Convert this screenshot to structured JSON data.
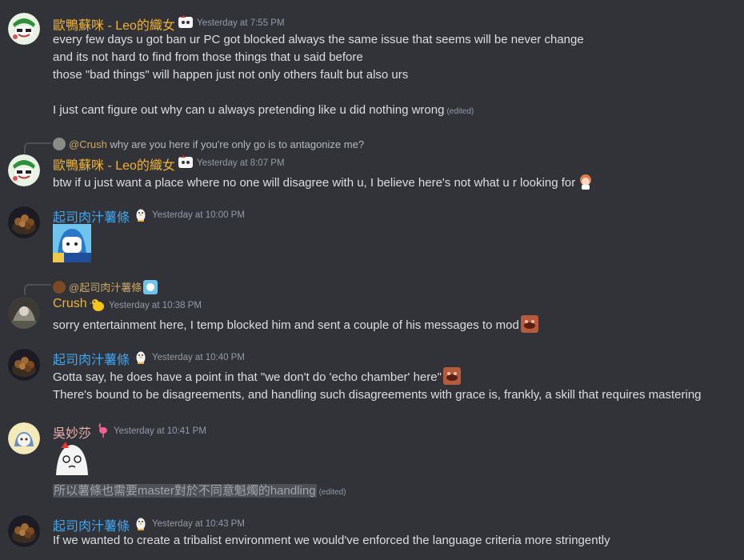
{
  "colors": {
    "background": "#313338",
    "text": "#dbdee1",
    "muted": "#949ba4",
    "gold_name": "#f0b232",
    "blue_name": "#3ea8f5",
    "pink_name": "#f0b0b0",
    "reply_mention": "#c9a86a"
  },
  "messages": [
    {
      "author": "歐鴨蘇咪 - Leo的織女",
      "timestamp": "Yesterday at 7:55 PM",
      "lines": [
        "every few days u got ban ur PC got blocked always the same issue that seems will be never change",
        "and its not hard to find from those things that u said before",
        "those \"bad things\" will happen just not only others fault but also urs",
        "I just cant figure out why can u always pretending like  u did nothing wrong"
      ],
      "edited": "(edited)"
    },
    {
      "reply": {
        "mention": "@Crush",
        "text": "why are you here if you're only go is to antagonize me?"
      },
      "author": "歐鴨蘇咪 - Leo的織女",
      "timestamp": "Yesterday at 8:07 PM",
      "lines": [
        "btw if u just want a place where no one will disagree with u, I believe here's not what u r looking for"
      ]
    },
    {
      "author": "起司肉汁薯條",
      "timestamp": "Yesterday at 10:00 PM",
      "lines": []
    },
    {
      "reply": {
        "mention": "@起司肉汁薯條",
        "text": ""
      },
      "author": "Crush",
      "timestamp": "Yesterday at 10:38 PM",
      "lines": [
        "sorry entertainment here, I temp blocked him and sent a couple  of his messages to mod"
      ]
    },
    {
      "author": "起司肉汁薯條",
      "timestamp": "Yesterday at 10:40 PM",
      "lines": [
        "Gotta say, he does have a point in that \"we don't do 'echo chamber' here\"",
        "There's bound to be disagreements, and handling such disagreements with grace is, frankly, a skill that requires mastering"
      ]
    },
    {
      "author": "吳妙莎",
      "timestamp": "Yesterday at 10:41 PM",
      "lines": [
        "所以薯條也需要master對於不同意魁燭的handling"
      ],
      "edited": "(edited)"
    },
    {
      "author": "起司肉汁薯條",
      "timestamp": "Yesterday at 10:43 PM",
      "lines": [
        "If we wanted to create a tribalist environment we would've enforced the language criteria more stringently"
      ]
    }
  ]
}
